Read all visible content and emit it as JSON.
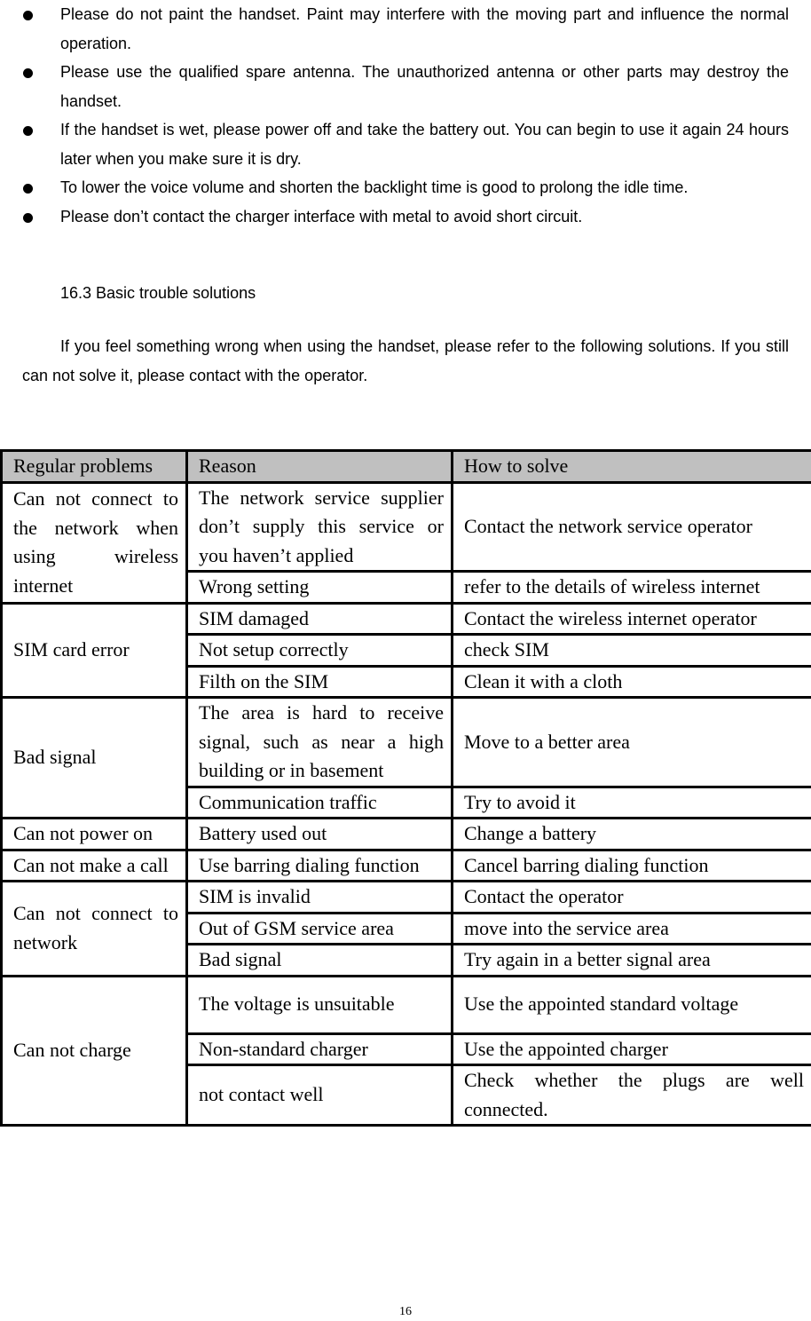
{
  "bullets": [
    "Please do not paint the handset. Paint may interfere with the moving part and influence the normal operation.",
    "Please use the qualified spare antenna. The unauthorized antenna or other parts may destroy the handset.",
    "If the handset is wet, please power off and take the battery out. You can begin to use it again 24 hours later when you make sure it is dry.",
    "To lower the voice volume and shorten the backlight time is good to prolong the idle time.",
    "Please don’t contact the charger interface with metal to avoid short circuit."
  ],
  "section_title": "16.3 Basic trouble solutions",
  "intro": "If you feel something wrong when using the handset, please refer to the following solutions. If you still can not solve it, please contact with the operator.",
  "table": {
    "headers": [
      "Regular problems",
      "Reason",
      "How to solve"
    ],
    "groups": [
      {
        "problem": "Can not connect to the network when using wireless internet",
        "rows": [
          {
            "reason": "The network service supplier don’t supply this service or you haven’t applied",
            "solution": "Contact the network service operator"
          },
          {
            "reason": "Wrong setting",
            "solution": "refer to the details of wireless internet"
          }
        ]
      },
      {
        "problem": "SIM card error",
        "rows": [
          {
            "reason": "SIM damaged",
            "solution": "Contact the wireless internet operator"
          },
          {
            "reason": "Not setup correctly",
            "solution": "check SIM"
          },
          {
            "reason": "Filth on the SIM",
            "solution": "Clean it with a cloth"
          }
        ]
      },
      {
        "problem": "Bad signal",
        "rows": [
          {
            "reason": "The area is hard to receive signal, such as near a high building or in basement",
            "solution": "Move to a better area"
          },
          {
            "reason": "Communication traffic",
            "solution": "Try to avoid it"
          }
        ]
      },
      {
        "problem": "Can not power on",
        "rows": [
          {
            "reason": "Battery used out",
            "solution": "Change a battery"
          }
        ]
      },
      {
        "problem": "Can not make a call",
        "rows": [
          {
            "reason": "Use barring dialing function",
            "solution": "Cancel barring dialing function"
          }
        ]
      },
      {
        "problem": "Can not connect to network",
        "rows": [
          {
            "reason": "SIM is invalid",
            "solution": "Contact the operator"
          },
          {
            "reason": "Out of GSM service area",
            "solution": "move into the service area"
          },
          {
            "reason": "Bad signal",
            "solution": "Try again in a better signal area"
          }
        ]
      },
      {
        "problem": "Can not charge",
        "rows": [
          {
            "reason": "The voltage is unsuitable",
            "solution": "Use the appointed standard voltage"
          },
          {
            "reason": "Non-standard charger",
            "solution": "Use the appointed charger"
          },
          {
            "reason": "not contact well",
            "solution": "Check whether the plugs are well connected."
          }
        ]
      }
    ]
  },
  "page_number": "16"
}
